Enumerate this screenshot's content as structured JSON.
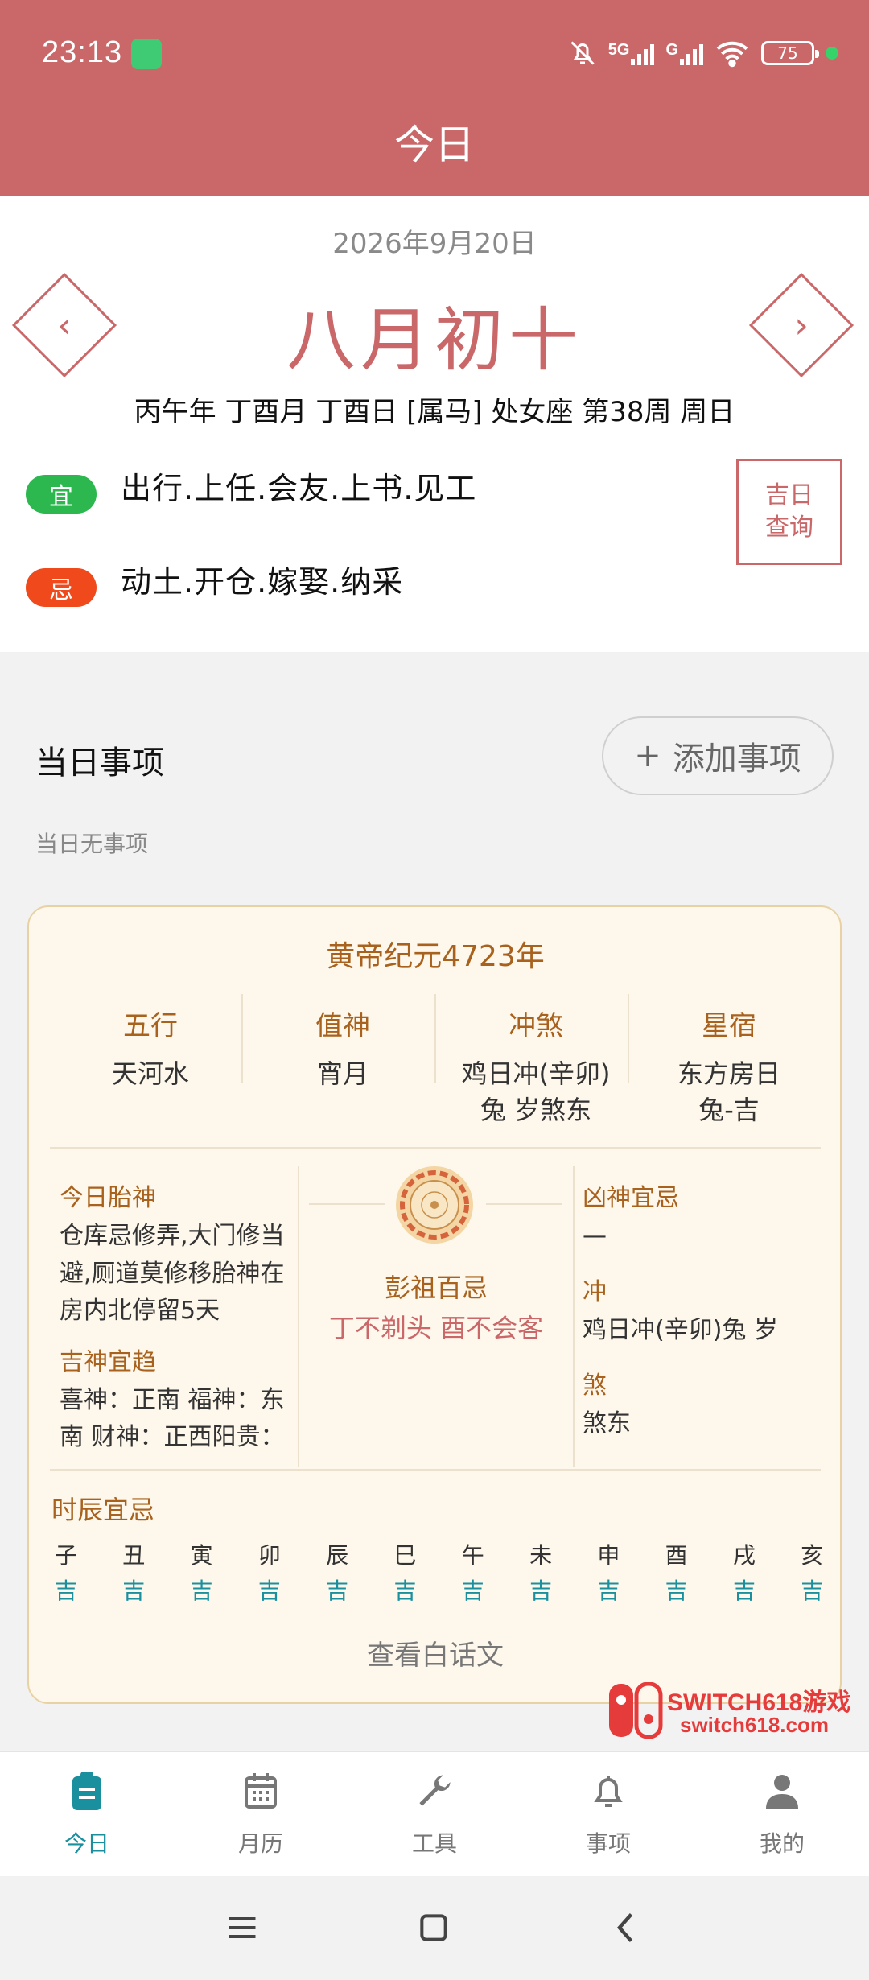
{
  "status_bar": {
    "time": "23:13",
    "battery": "75",
    "signal1": "5G",
    "signal2": "G"
  },
  "header": {
    "title": "今日"
  },
  "date_card": {
    "solar_date": "2026年9月20日",
    "prev_icon": "chevron-left-icon",
    "next_icon": "chevron-right-icon",
    "lunar_date": "八月初十",
    "ganzhi": "丙午年 丁酉月 丁酉日 [属马] 处女座 第38周 周日",
    "yi_label": "宜",
    "yi_text": "出行.上任.会友.上书.见工",
    "ji_label": "忌",
    "ji_text": "动土.开仓.嫁娶.纳采",
    "jiri_line1": "吉日",
    "jiri_line2": "查询",
    "colors": {
      "accent": "#c96769",
      "yi": "#2db84f",
      "ji": "#f04a1c"
    }
  },
  "events": {
    "title": "当日事项",
    "add_label": "添加事项",
    "empty_text": "当日无事项"
  },
  "almanac": {
    "era": "黄帝纪元4723年",
    "columns": [
      {
        "title": "五行",
        "value": "天河水",
        "value2": ""
      },
      {
        "title": "值神",
        "value": "宵月",
        "value2": ""
      },
      {
        "title": "冲煞",
        "value": "鸡日冲(辛卯)",
        "value2": "兔 岁煞东"
      },
      {
        "title": "星宿",
        "value": "东方房日",
        "value2": "兔-吉"
      }
    ],
    "taishen_title": "今日胎神",
    "taishen_text": "仓库忌修弄,大门修当避,厕道莫修移胎神在房内北停留5天",
    "jishen_title": "吉神宜趋",
    "jishen_text": "喜神：正南 福神：东南 财神：正西阳贵：",
    "pengzu_title": "彭祖百忌",
    "pengzu_text": "丁不剃头 酉不会客",
    "xiongshen_title": "凶神宜忌",
    "xiongshen_text": "—",
    "chong_title": "冲",
    "chong_text": "鸡日冲(辛卯)兔 岁",
    "sha_title": "煞",
    "sha_text": "煞东",
    "hours_title": "时辰宜忌",
    "hours": [
      {
        "name": "子",
        "status": "吉"
      },
      {
        "name": "丑",
        "status": "吉"
      },
      {
        "name": "寅",
        "status": "吉"
      },
      {
        "name": "卯",
        "status": "吉"
      },
      {
        "name": "辰",
        "status": "吉"
      },
      {
        "name": "巳",
        "status": "吉"
      },
      {
        "name": "午",
        "status": "吉"
      },
      {
        "name": "未",
        "status": "吉"
      },
      {
        "name": "申",
        "status": "吉"
      },
      {
        "name": "酉",
        "status": "吉"
      },
      {
        "name": "戌",
        "status": "吉"
      },
      {
        "name": "亥",
        "status": "吉"
      }
    ],
    "view_plain": "查看白话文"
  },
  "watermark": {
    "line1": "SWITCH618游戏",
    "line2": "switch618.com"
  },
  "bottom_nav": {
    "tabs": [
      {
        "label": "今日",
        "icon": "clipboard-icon",
        "active": true
      },
      {
        "label": "月历",
        "icon": "calendar-icon",
        "active": false
      },
      {
        "label": "工具",
        "icon": "wrench-icon",
        "active": false
      },
      {
        "label": "事项",
        "icon": "bell-icon",
        "active": false
      },
      {
        "label": "我的",
        "icon": "person-icon",
        "active": false
      }
    ],
    "active_color": "#1a8f9e"
  }
}
